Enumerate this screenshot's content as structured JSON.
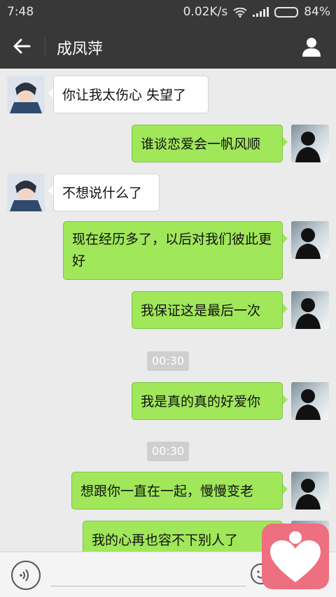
{
  "status": {
    "time": "7:48",
    "speed": "0.02K/s",
    "battery": "84%",
    "battery_level": 0.84
  },
  "header": {
    "title": "成凤萍"
  },
  "messages": [
    {
      "side": "left",
      "text": "你让我太伤心 失望了"
    },
    {
      "side": "right",
      "text": "谁谈恋爱会一帆风顺"
    },
    {
      "side": "left",
      "text": "不想说什么了"
    },
    {
      "side": "right",
      "text": "现在经历多了，以后对我们彼此更好"
    },
    {
      "side": "right",
      "text": "我保证这是最后一次"
    },
    {
      "type": "timestamp",
      "text": "00:30"
    },
    {
      "side": "right",
      "text": "我是真的真的好爱你"
    },
    {
      "type": "timestamp",
      "text": "00:30"
    },
    {
      "side": "right",
      "text": "想跟你一直在一起，慢慢变老"
    },
    {
      "side": "right",
      "text": "我的心再也容不下别人了"
    }
  ],
  "icons": {
    "back": "arrow-left-icon",
    "contact": "person-icon",
    "voice": "voice-icon",
    "emoji": "emoji-icon",
    "overlay": "heart-icon"
  },
  "colors": {
    "header_bg": "#383838",
    "chat_bg": "#ebebeb",
    "outgoing_bubble": "#a0e75a",
    "incoming_bubble": "#ffffff",
    "heart_badge": "#ee6f80"
  }
}
